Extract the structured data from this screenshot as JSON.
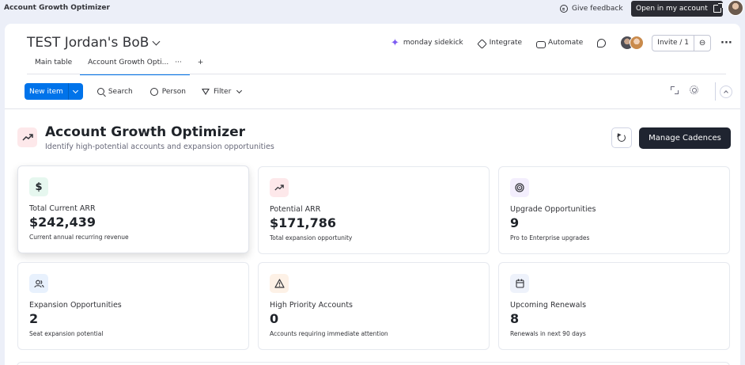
{
  "app": {
    "title": "Account Growth Optimizer"
  },
  "topbar": {
    "feedback_label": "Give feedback",
    "open_account_label": "Open in my account"
  },
  "board": {
    "title": "TEST Jordan's BoB",
    "actions": {
      "sidekick": "monday sidekick",
      "integrate": "Integrate",
      "automate": "Automate",
      "invite": "Invite / 1"
    },
    "tabs": [
      {
        "label": "Main table"
      },
      {
        "label": "Account Growth Opti..."
      }
    ],
    "tab_more": "···",
    "tab_add": "+"
  },
  "toolbar": {
    "new_item": "New item",
    "search": "Search",
    "person": "Person",
    "filter": "Filter"
  },
  "optimizer": {
    "title": "Account Growth Optimizer",
    "subtitle": "Identify high-potential accounts and expansion opportunities",
    "manage_label": "Manage Cadences"
  },
  "cards": [
    {
      "label": "Total Current ARR",
      "value": "$242,439",
      "desc": "Current annual recurring revenue",
      "icon": "dollar-icon",
      "glyph": "$",
      "bg": "#e6f7ef",
      "color": "#1f2329"
    },
    {
      "label": "Potential ARR",
      "value": "$171,786",
      "desc": "Total expansion opportunity",
      "icon": "trend-up-icon",
      "glyph": "",
      "bg": "#fde8ea",
      "color": "#1f2329"
    },
    {
      "label": "Upgrade Opportunities",
      "value": "9",
      "desc": "Pro to Enterprise upgrades",
      "icon": "target-icon",
      "glyph": "◎",
      "bg": "#f3eefd",
      "color": "#1f2329"
    },
    {
      "label": "Expansion Opportunities",
      "value": "2",
      "desc": "Seat expansion potential",
      "icon": "users-icon",
      "glyph": "",
      "bg": "#e8f1fd",
      "color": "#1f2329"
    },
    {
      "label": "High Priority Accounts",
      "value": "0",
      "desc": "Accounts requiring immediate attention",
      "icon": "warning-icon",
      "glyph": "⚠",
      "bg": "#fdf1e6",
      "color": "#1f2329"
    },
    {
      "label": "Upcoming Renewals",
      "value": "8",
      "desc": "Renewals in next 90 days",
      "icon": "calendar-icon",
      "glyph": "",
      "bg": "#eef2fb",
      "color": "#1f2329"
    }
  ]
}
